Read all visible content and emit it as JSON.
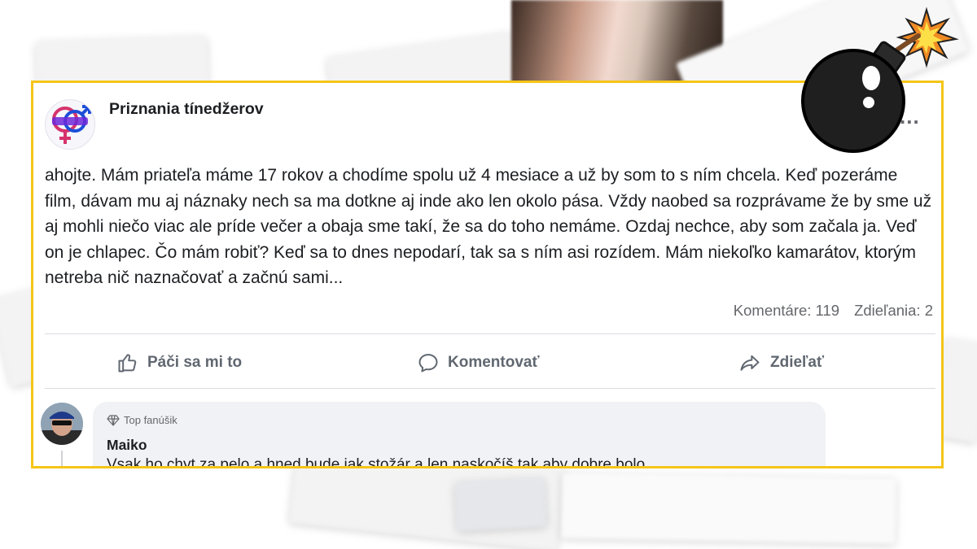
{
  "post": {
    "page_name": "Priznania tínedžerov",
    "menu_label": "...",
    "body": "ahojte. Mám priateľa máme 17 rokov a chodíme spolu už 4 mesiace a už by som to s ním chcela. Keď pozeráme film, dávam mu aj náznaky nech sa ma dotkne aj inde ako len okolo pása. Vždy naobed sa rozprávame že by sme už aj mohli niečo viac ale príde večer a obaja sme takí, že sa do toho nemáme. Ozdaj nechce, aby som začala ja. Veď on je chlapec. Čo mám robiť? Keď sa to dnes nepodarí, tak sa s ním asi rozídem. Mám niekoľko kamarátov, ktorým netreba nič naznačovať a začnú sami...",
    "comments_count": "Komentáre: 119",
    "shares_count": "Zdieľania: 2"
  },
  "actions": {
    "like": "Páči sa mi to",
    "comment": "Komentovať",
    "share": "Zdieľať"
  },
  "comment": {
    "badge": "Top fanúšik",
    "author": "Maiko",
    "text": "Vsak ho chyt za pelo a hned bude jak stožár a len naskočíš tak aby dobre bolo"
  },
  "colors": {
    "frame": "#f5c518",
    "text": "#1c1e21",
    "secondary": "#65676b",
    "bubble": "#f0f2f5"
  },
  "icons": [
    "like-icon",
    "comment-icon",
    "share-icon",
    "diamond-icon",
    "bomb-icon",
    "more-icon"
  ]
}
